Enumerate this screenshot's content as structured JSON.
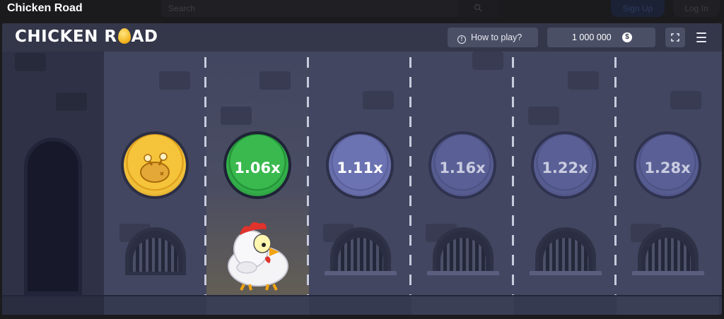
{
  "site": {
    "title": "Chicken Road",
    "search_placeholder": "Search",
    "search_button_icon": "search-icon",
    "signup_label": "Sign Up",
    "login_label": "Log In"
  },
  "game": {
    "logo_text_left": "CHICKEN R",
    "logo_text_right": "AD",
    "logo_egg_icon": "golden-egg-icon",
    "how_to_play_label": "How to play?",
    "balance": "1 000 000",
    "currency_icon": "dollar-coin-icon",
    "currency_symbol": "$",
    "fullscreen_icon": "fullscreen-icon",
    "menu_icon": "hamburger-menu-icon"
  },
  "lanes": [
    {
      "state": "passed",
      "coin_icon": "roast-chicken-icon"
    },
    {
      "state": "current",
      "multiplier": "1.06x"
    },
    {
      "state": "next",
      "multiplier": "1.11x"
    },
    {
      "state": "upcoming",
      "multiplier": "1.16x"
    },
    {
      "state": "upcoming",
      "multiplier": "1.22x"
    },
    {
      "state": "upcoming",
      "multiplier": "1.28x"
    }
  ],
  "colors": {
    "background": "#41455f",
    "header": "#34374a",
    "current_coin": "#39b94e",
    "passed_coin": "#f6c43a",
    "next_coin": "#6c73b2"
  }
}
